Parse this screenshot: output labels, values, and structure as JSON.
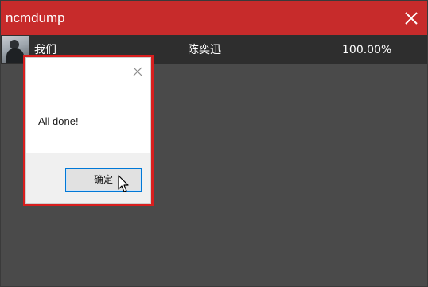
{
  "window": {
    "title": "ncmdump",
    "colors": {
      "titlebar": "#c72b2b",
      "background": "#4a4a4a",
      "row": "#2e2e2e"
    }
  },
  "song_list": [
    {
      "title": "我们",
      "artist": "陈奕迅",
      "progress": "100.00%",
      "cover_icon": "album-cover"
    }
  ],
  "dialog": {
    "message": "All done!",
    "ok_label": "确定",
    "close_icon": "close-icon",
    "highlight_color": "#d81e1e"
  },
  "icons": {
    "window_close": "close-icon",
    "pointer": "mouse-pointer-icon"
  }
}
